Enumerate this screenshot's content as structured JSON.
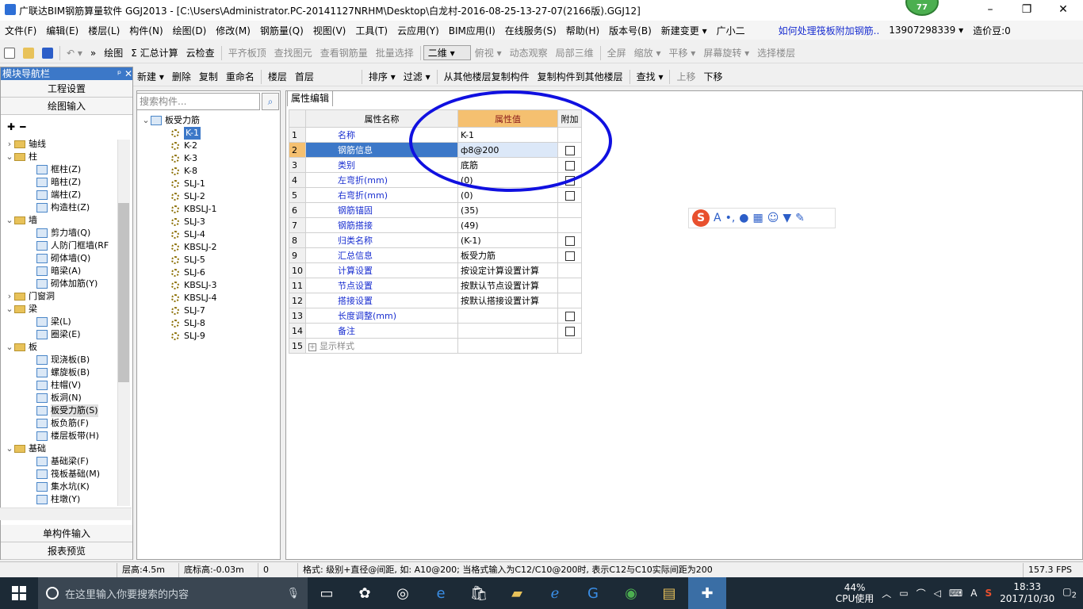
{
  "window": {
    "title": "广联达BIM钢筋算量软件 GGJ2013 - [C:\\Users\\Administrator.PC-20141127NRHM\\Desktop\\白龙村-2016-08-25-13-27-07(2166版).GGJ12]",
    "badge": "77",
    "minimize": "–",
    "maximize": "❐",
    "close": "✕"
  },
  "menubar": {
    "items": [
      "文件(F)",
      "编辑(E)",
      "楼层(L)",
      "构件(N)",
      "绘图(D)",
      "修改(M)",
      "钢筋量(Q)",
      "视图(V)",
      "工具(T)",
      "云应用(Y)",
      "BIM应用(I)",
      "在线服务(S)",
      "帮助(H)",
      "版本号(B)",
      "新建变更 ▾",
      "广小二",
      "如何处理筏板附加钢筋..",
      "13907298339 ▾",
      "造价豆:0"
    ]
  },
  "toolbar1": {
    "items": [
      "绘图",
      "Σ 汇总计算",
      "云检查",
      "平齐板顶",
      "查找图元",
      "查看钢筋量",
      "批量选择",
      "二维 ▾",
      "俯视 ▾",
      "动态观察",
      "局部三维",
      "全屏",
      "缩放 ▾",
      "平移 ▾",
      "屏幕旋转 ▾",
      "选择楼层"
    ]
  },
  "toolbar2": {
    "items": [
      "新建 ▾",
      "删除",
      "复制",
      "重命名",
      "楼层",
      "首层",
      "排序 ▾",
      "过滤 ▾",
      "从其他楼层复制构件",
      "复制构件到其他楼层",
      "查找 ▾",
      "上移",
      "下移"
    ]
  },
  "left_panel": {
    "header": "模块导航栏",
    "pin": "ᵖ ✕",
    "btn_project": "工程设置",
    "btn_draw": "绘图输入",
    "tree": [
      {
        "type": "folder",
        "label": "轴线",
        "exp": "›"
      },
      {
        "type": "folder",
        "label": "柱",
        "exp": "⌄"
      },
      {
        "type": "item",
        "label": "框柱(Z)"
      },
      {
        "type": "item",
        "label": "暗柱(Z)"
      },
      {
        "type": "item",
        "label": "端柱(Z)"
      },
      {
        "type": "item",
        "label": "构造柱(Z)"
      },
      {
        "type": "folder",
        "label": "墙",
        "exp": "⌄"
      },
      {
        "type": "item",
        "label": "剪力墙(Q)"
      },
      {
        "type": "item",
        "label": "人防门框墙(RF"
      },
      {
        "type": "item",
        "label": "砌体墙(Q)"
      },
      {
        "type": "item",
        "label": "暗梁(A)"
      },
      {
        "type": "item",
        "label": "砌体加筋(Y)"
      },
      {
        "type": "folder",
        "label": "门窗洞",
        "exp": "›"
      },
      {
        "type": "folder",
        "label": "梁",
        "exp": "⌄"
      },
      {
        "type": "item",
        "label": "梁(L)"
      },
      {
        "type": "item",
        "label": "圈梁(E)"
      },
      {
        "type": "folder",
        "label": "板",
        "exp": "⌄"
      },
      {
        "type": "item",
        "label": "现浇板(B)"
      },
      {
        "type": "item",
        "label": "螺旋板(B)"
      },
      {
        "type": "item",
        "label": "柱帽(V)"
      },
      {
        "type": "item",
        "label": "板洞(N)"
      },
      {
        "type": "item",
        "label": "板受力筋(S)",
        "selected": true
      },
      {
        "type": "item",
        "label": "板负筋(F)"
      },
      {
        "type": "item",
        "label": "楼层板带(H)"
      },
      {
        "type": "folder",
        "label": "基础",
        "exp": "⌄"
      },
      {
        "type": "item",
        "label": "基础梁(F)"
      },
      {
        "type": "item",
        "label": "筏板基础(M)"
      },
      {
        "type": "item",
        "label": "集水坑(K)"
      },
      {
        "type": "item",
        "label": "柱墩(Y)"
      }
    ],
    "btn_single": "单构件输入",
    "btn_report": "报表预览"
  },
  "component_panel": {
    "search_placeholder": "搜索构件...",
    "root": "板受力筋",
    "items": [
      "K-1",
      "K-2",
      "K-3",
      "K-8",
      "SLJ-1",
      "SLJ-2",
      "KBSLJ-1",
      "SLJ-3",
      "SLJ-4",
      "KBSLJ-2",
      "SLJ-5",
      "SLJ-6",
      "KBSLJ-3",
      "KBSLJ-4",
      "SLJ-7",
      "SLJ-8",
      "SLJ-9"
    ]
  },
  "property_editor": {
    "tab": "属性编辑",
    "headers": {
      "name": "属性名称",
      "value": "属性值",
      "extra": "附加"
    },
    "rows": [
      {
        "n": "1",
        "name": "名称",
        "value": "K-1",
        "cb": false
      },
      {
        "n": "2",
        "name": "钢筋信息",
        "value": "ф8@200",
        "cb": true,
        "selected": true
      },
      {
        "n": "3",
        "name": "类别",
        "value": "底筋",
        "cb": true
      },
      {
        "n": "4",
        "name": "左弯折(mm)",
        "value": "(0)",
        "cb": true
      },
      {
        "n": "5",
        "name": "右弯折(mm)",
        "value": "(0)",
        "cb": true
      },
      {
        "n": "6",
        "name": "钢筋锚固",
        "value": "(35)",
        "cb": false
      },
      {
        "n": "7",
        "name": "钢筋搭接",
        "value": "(49)",
        "cb": false
      },
      {
        "n": "8",
        "name": "归类名称",
        "value": "(K-1)",
        "cb": true
      },
      {
        "n": "9",
        "name": "汇总信息",
        "value": "板受力筋",
        "cb": true
      },
      {
        "n": "10",
        "name": "计算设置",
        "value": "按设定计算设置计算",
        "cb": false
      },
      {
        "n": "11",
        "name": "节点设置",
        "value": "按默认节点设置计算",
        "cb": false
      },
      {
        "n": "12",
        "name": "搭接设置",
        "value": "按默认搭接设置计算",
        "cb": false
      },
      {
        "n": "13",
        "name": "长度调整(mm)",
        "value": "",
        "cb": true
      },
      {
        "n": "14",
        "name": "备注",
        "value": "",
        "cb": true
      },
      {
        "n": "15",
        "name": "显示样式",
        "value": "",
        "cb": false,
        "expander": "+"
      }
    ]
  },
  "statusbar": {
    "floor_height": "层高:4.5m",
    "bottom_elev": "底标高:-0.03m",
    "count": "0",
    "hint": "格式: 级别+直径@间距, 如: A10@200; 当格式输入为C12/C10@200时, 表示C12与C10实际间距为200",
    "fps": "157.3 FPS"
  },
  "taskbar": {
    "search_placeholder": "在这里输入你要搜索的内容",
    "cpu": "44%",
    "cpu_label": "CPU使用",
    "time": "18:33",
    "date": "2017/10/30",
    "lang": "A",
    "notif": "2"
  },
  "colors": {
    "accent": "#3c78c8",
    "selected_row": "#3c78c8",
    "value_header": "#f5c070",
    "annotation_circle": "#1010e0"
  }
}
